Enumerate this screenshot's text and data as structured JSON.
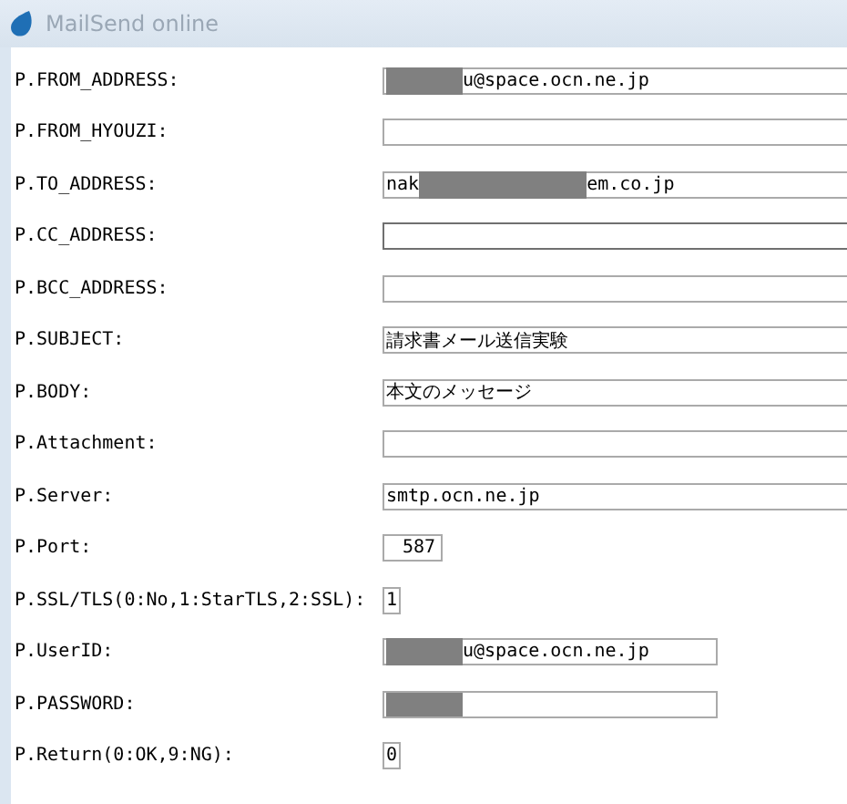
{
  "window": {
    "title": "MailSend online"
  },
  "rows": [
    {
      "label": "P.FROM_ADDRESS:",
      "kind": "wide",
      "focused": false,
      "value": [
        {
          "kind": "redaction"
        },
        {
          "kind": "text",
          "text": "u@space.ocn.ne.jp"
        }
      ]
    },
    {
      "label": "P.FROM_HYOUZI:",
      "kind": "wide",
      "focused": false,
      "value": []
    },
    {
      "label": "P.TO_ADDRESS:",
      "kind": "wide",
      "focused": false,
      "value": [
        {
          "kind": "text",
          "text": "nak"
        },
        {
          "kind": "redaction"
        },
        {
          "kind": "text",
          "text": "em.co.jp"
        }
      ]
    },
    {
      "label": "P.CC_ADDRESS:",
      "kind": "wide",
      "focused": true,
      "value": []
    },
    {
      "label": "P.BCC_ADDRESS:",
      "kind": "wide",
      "focused": false,
      "value": []
    },
    {
      "label": "P.SUBJECT:",
      "kind": "wide",
      "focused": false,
      "value": [
        {
          "kind": "text",
          "text": "請求書メール送信実験"
        }
      ]
    },
    {
      "label": "P.BODY:",
      "kind": "wide",
      "focused": false,
      "value": [
        {
          "kind": "text",
          "text": "本文のメッセージ"
        }
      ]
    },
    {
      "label": "P.Attachment:",
      "kind": "wide",
      "focused": false,
      "value": []
    },
    {
      "label": "P.Server:",
      "kind": "wide",
      "focused": false,
      "value": [
        {
          "kind": "text",
          "text": "smtp.ocn.ne.jp"
        }
      ]
    },
    {
      "label": "P.Port:",
      "kind": "short",
      "focused": false,
      "value": [
        {
          "kind": "text",
          "text": "587"
        }
      ]
    },
    {
      "label": "P.SSL/TLS(0:No,1:StarTLS,2:SSL):",
      "kind": "tiny",
      "focused": false,
      "value": [
        {
          "kind": "text",
          "text": "1"
        }
      ]
    },
    {
      "label": "P.UserID:",
      "kind": "medium",
      "focused": false,
      "value": [
        {
          "kind": "redaction"
        },
        {
          "kind": "text",
          "text": "u@space.ocn.ne.jp"
        }
      ]
    },
    {
      "label": "P.PASSWORD:",
      "kind": "medium",
      "focused": false,
      "value": [
        {
          "kind": "redaction"
        }
      ]
    },
    {
      "label": "P.Return(0:OK,9:NG):",
      "kind": "tiny",
      "focused": false,
      "value": [
        {
          "kind": "text",
          "text": "0"
        }
      ]
    }
  ]
}
